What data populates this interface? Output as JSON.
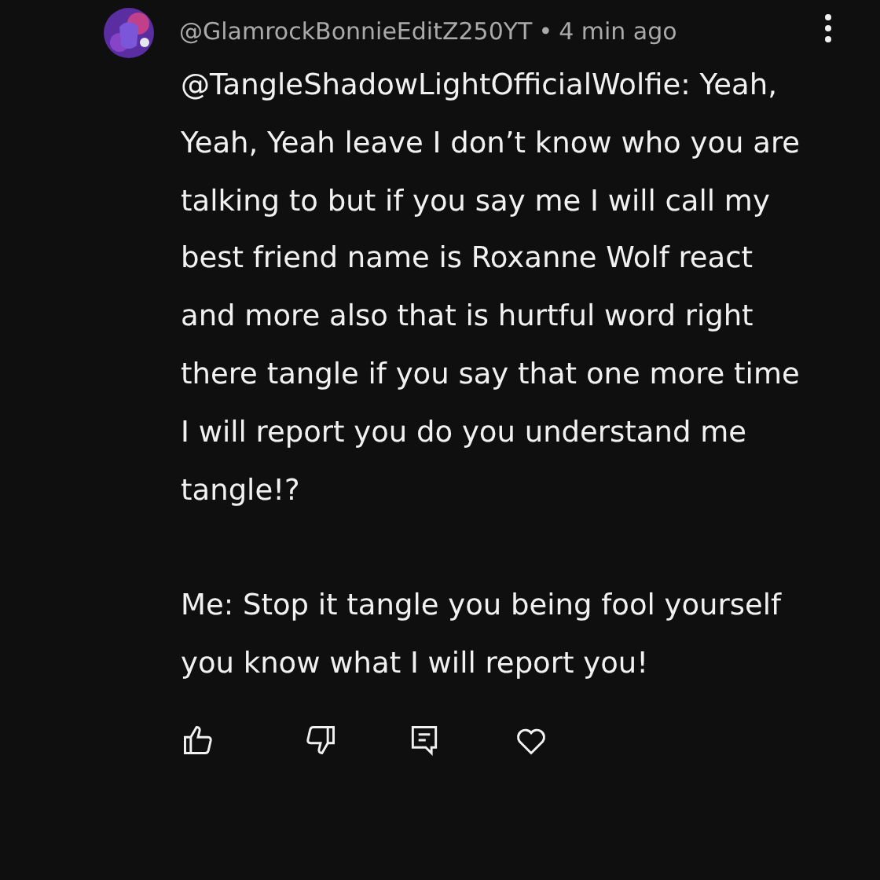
{
  "comment": {
    "author": "@GlamrockBonnieEditZ250YT",
    "separator": "•",
    "time": "4 min ago",
    "paragraphs": [
      "@TangleShadowLightOfficialWolfie: Yeah, Yeah, Yeah leave I don’t know who you are talking to but if you say me I will call my best friend name is Roxanne Wolf react and more also that is hurtful word right there tangle if you say that one more time I will report you do you understand me tangle!?",
      "Me: Stop it tangle you being fool yourself you know what I will report you!"
    ]
  }
}
